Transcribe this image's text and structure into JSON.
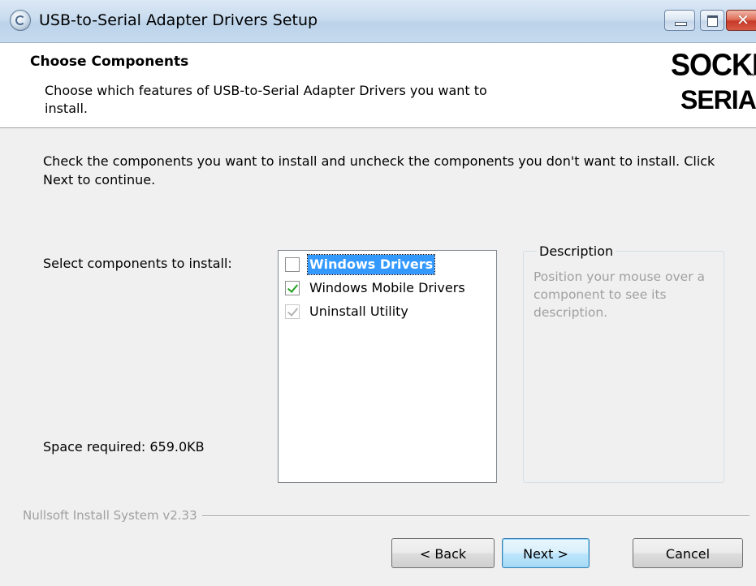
{
  "window": {
    "title": "USB-to-Serial Adapter Drivers Setup",
    "icon": "installer-cd-icon",
    "controls": [
      "minimize",
      "maximize",
      "close"
    ]
  },
  "header": {
    "title": "Choose Components",
    "subtitle": "Choose which features of USB-to-Serial Adapter Drivers you want to install.",
    "logo": {
      "line1": "SOCKET",
      "line2": "SERIAL",
      "mark": "™"
    }
  },
  "body": {
    "instructions": "Check the components you want to install and uncheck the components you don't want to install. Click Next to continue.",
    "select_label": "Select components to install:",
    "space_required": "Space required: 659.0KB",
    "components": [
      {
        "label": "Windows Drivers",
        "checked": false,
        "selected": true,
        "disabled": false
      },
      {
        "label": "Windows Mobile Drivers",
        "checked": true,
        "selected": false,
        "disabled": false
      },
      {
        "label": "Uninstall Utility",
        "checked": true,
        "selected": false,
        "disabled": true
      }
    ],
    "description": {
      "legend": "Description",
      "text": "Position your mouse over a component to see its description."
    }
  },
  "footer": {
    "brand": "Nullsoft Install System v2.33",
    "back_label": "< Back",
    "next_label": "Next >",
    "cancel_label": "Cancel"
  },
  "colors": {
    "selection": "#3399ff",
    "check": "#21a121",
    "disabled_text": "#a0a0a0"
  }
}
